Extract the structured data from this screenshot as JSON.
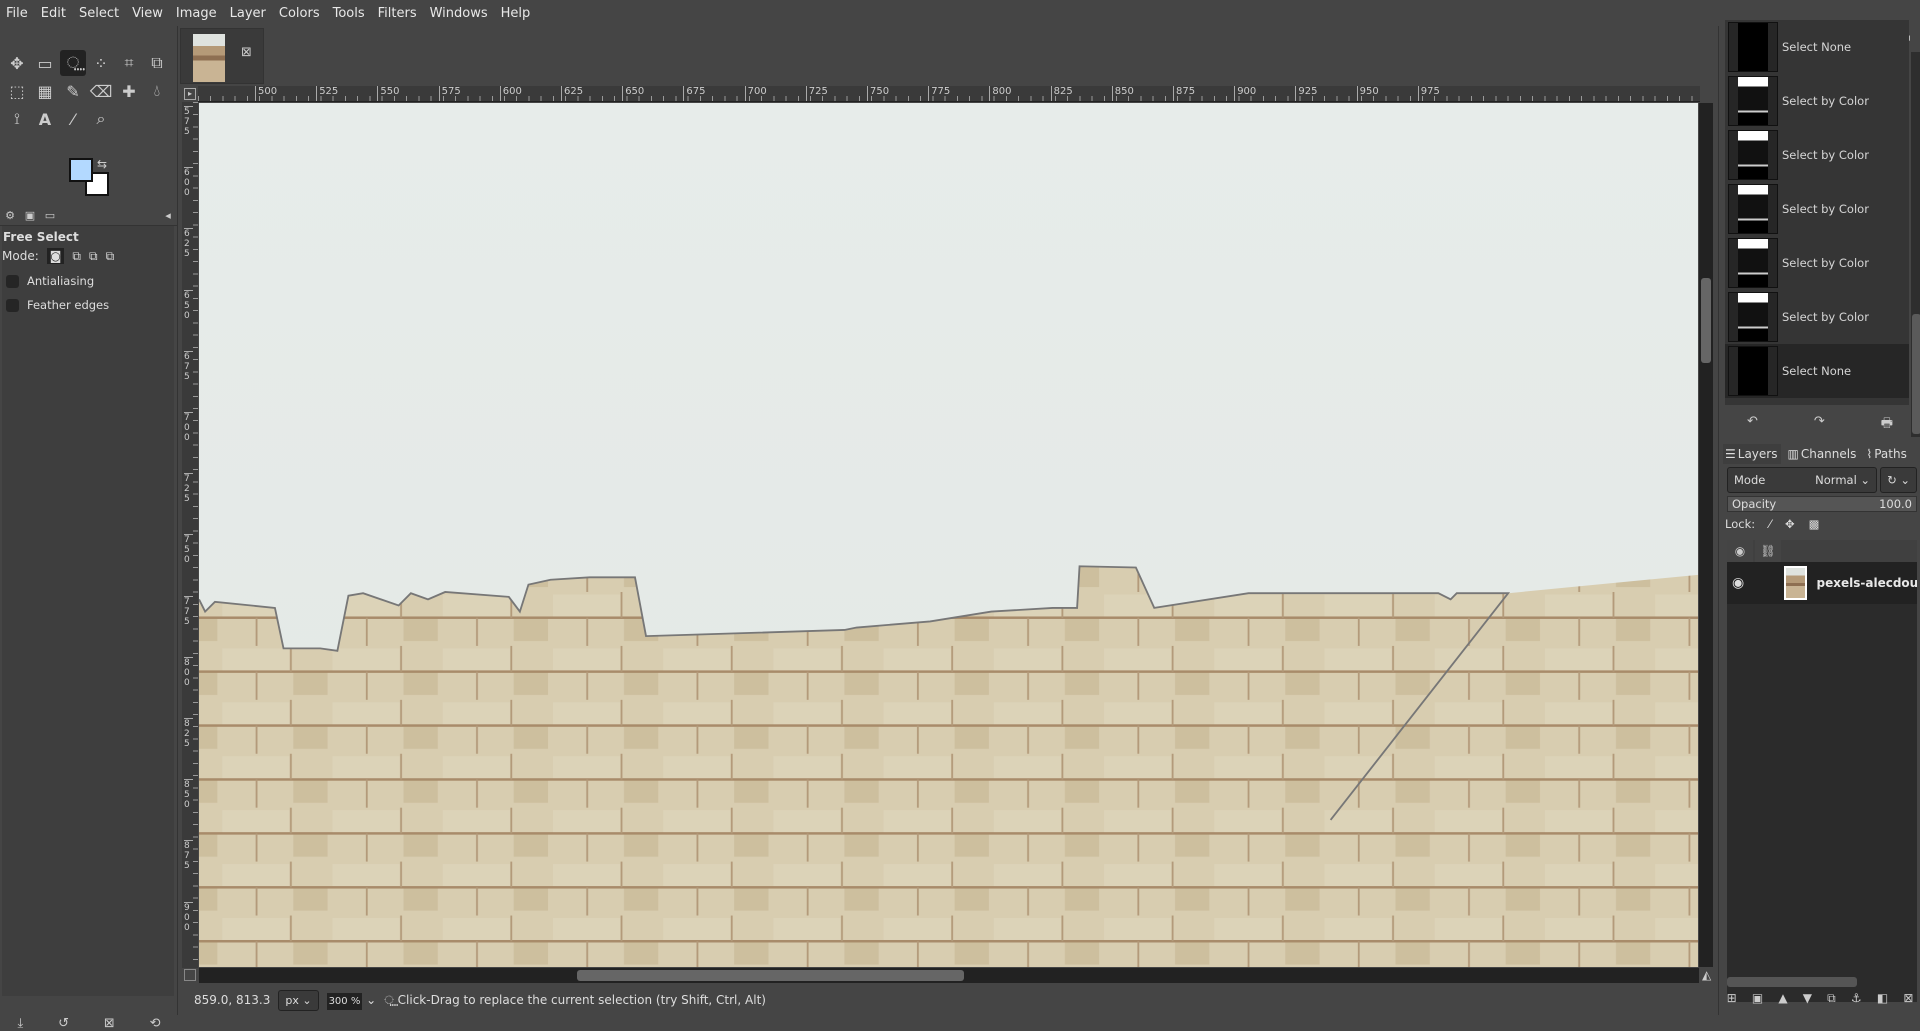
{
  "menu": [
    "File",
    "Edit",
    "Select",
    "View",
    "Image",
    "Layer",
    "Colors",
    "Tools",
    "Filters",
    "Windows",
    "Help"
  ],
  "colors": {
    "foreground": "#b3d9ff",
    "background": "#ffffff"
  },
  "tool_options": {
    "title": "Free Select",
    "mode_label": "Mode:",
    "antialiasing": "Antialiasing",
    "feather": "Feather edges",
    "antialiasing_checked": false,
    "feather_checked": false
  },
  "ruler": {
    "h": [
      "500",
      "525",
      "550",
      "575",
      "600",
      "625",
      "650",
      "675",
      "700",
      "725",
      "750",
      "775",
      "800",
      "825",
      "850",
      "875",
      "900",
      "925",
      "950",
      "975"
    ],
    "v": [
      "575",
      "600",
      "625",
      "650",
      "675",
      "700",
      "725",
      "750",
      "775",
      "800",
      "825",
      "850",
      "875",
      "900"
    ]
  },
  "status": {
    "coords": "859.0, 813.3",
    "unit": "px",
    "zoom": "300 %",
    "message": "Click-Drag to replace the current selection (try Shift, Ctrl, Alt)"
  },
  "history": [
    {
      "label": "Select None",
      "thumb": "black"
    },
    {
      "label": "Select by Color",
      "thumb": "mask"
    },
    {
      "label": "Select by Color",
      "thumb": "mask"
    },
    {
      "label": "Select by Color",
      "thumb": "mask"
    },
    {
      "label": "Select by Color",
      "thumb": "mask"
    },
    {
      "label": "Select by Color",
      "thumb": "mask"
    },
    {
      "label": "Select None",
      "thumb": "black",
      "current": true
    }
  ],
  "layers_panel": {
    "tabs": [
      "Layers",
      "Channels",
      "Paths"
    ],
    "mode_label": "Mode",
    "mode": "Normal",
    "opacity_label": "Opacity",
    "opacity": "100.0",
    "lock_label": "Lock:",
    "layers": [
      {
        "name": "pexels-alecdoua",
        "visible": true
      }
    ]
  }
}
